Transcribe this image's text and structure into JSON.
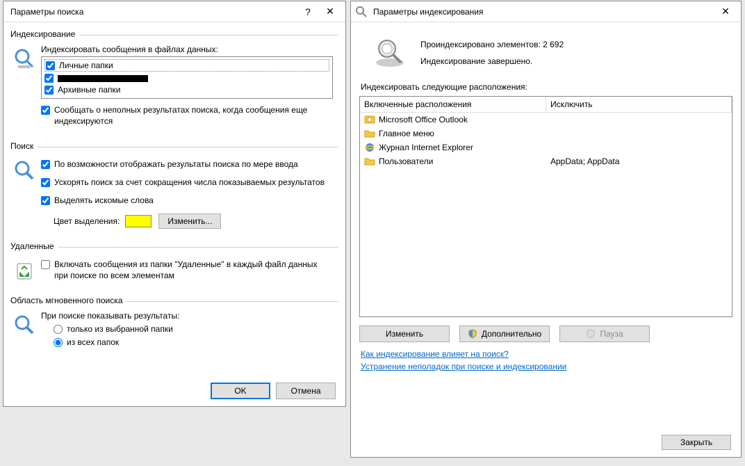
{
  "dialog_left": {
    "title": "Параметры поиска",
    "help_glyph": "?",
    "close_glyph": "✕",
    "groups": {
      "indexing": {
        "header": "Индексирование",
        "label_data_files": "Индексировать сообщения в файлах данных:",
        "items": [
          {
            "label": "Личные папки",
            "checked": true
          },
          {
            "label": "[redacted]",
            "checked": true
          },
          {
            "label": "Архивные папки",
            "checked": true
          }
        ],
        "partial_results_label": "Сообщать о неполных результатах поиска, когда сообщения еще индексируются",
        "partial_checked": true
      },
      "search": {
        "header": "Поиск",
        "opt_as_type": "По возможности отображать результаты поиска по мере ввода",
        "opt_speed": "Ускорять поиск за счет сокращения числа показываемых результатов",
        "opt_highlight": "Выделять искомые слова",
        "color_label": "Цвет выделения:",
        "change_btn": "Изменить..."
      },
      "deleted": {
        "header": "Удаленные",
        "opt_include": "Включать сообщения из папки \"Удаленные\" в каждый файл данных при поиске по всем элементам"
      },
      "scope": {
        "header": "Область мгновенного поиска",
        "label": "При поиске показывать результаты:",
        "opt_current": "только из выбранной папки",
        "opt_all": "из всех папок"
      }
    },
    "ok": "OK",
    "cancel": "Отмена"
  },
  "dialog_right": {
    "title": "Параметры индексирования",
    "close_glyph": "✕",
    "indexed_count_line": "Проиндексировано элементов: 2 692",
    "status_line": "Индексирование завершено.",
    "locations_label": "Индексировать следующие расположения:",
    "columns": {
      "included": "Включенные расположения",
      "exclude": "Исключить"
    },
    "rows": [
      {
        "icon": "outlook",
        "included": "Microsoft Office Outlook",
        "exclude": ""
      },
      {
        "icon": "folder",
        "included": "Главное меню",
        "exclude": ""
      },
      {
        "icon": "ie",
        "included": "Журнал Internet Explorer",
        "exclude": ""
      },
      {
        "icon": "folder",
        "included": "Пользователи",
        "exclude": "AppData; AppData"
      }
    ],
    "btn_modify": "Изменить",
    "btn_advanced": "Дополнительно",
    "btn_pause": "Пауза",
    "link_how": "Как индексирование влияет на поиск?",
    "link_troubleshoot": "Устранение неполадок при поиске и индексировании",
    "btn_close": "Закрыть"
  }
}
